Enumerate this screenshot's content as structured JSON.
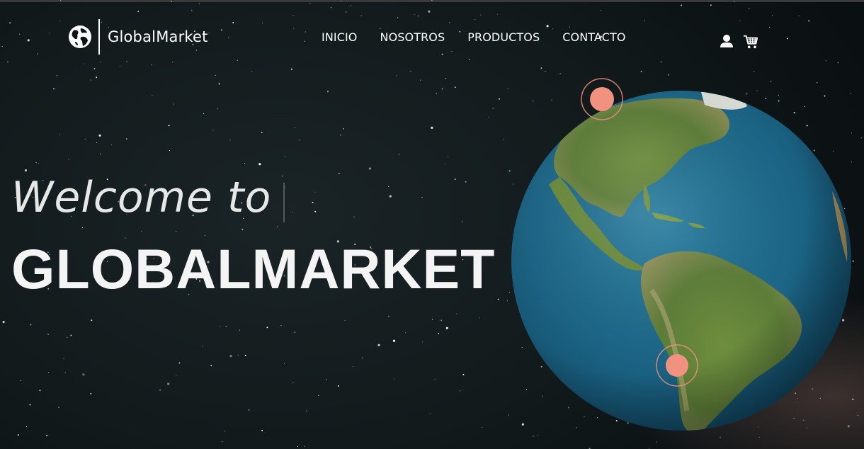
{
  "header": {
    "brand_name": "GlobalMarket",
    "logo_icon": "globe-icon",
    "nav": [
      {
        "label": "INICIO"
      },
      {
        "label": "NOSOTROS"
      },
      {
        "label": "PRODUCTOS"
      },
      {
        "label": "CONTACTO"
      }
    ],
    "icons": [
      "user-icon",
      "shopping-cart-icon"
    ]
  },
  "hero": {
    "welcome_text": "Welcome to",
    "title": "GLOBALMARKET",
    "location_markers": 2
  },
  "colors": {
    "background": "#121a1c",
    "text": "#ffffff",
    "marker": "#f0927f",
    "ocean": "#1f6a8c"
  }
}
